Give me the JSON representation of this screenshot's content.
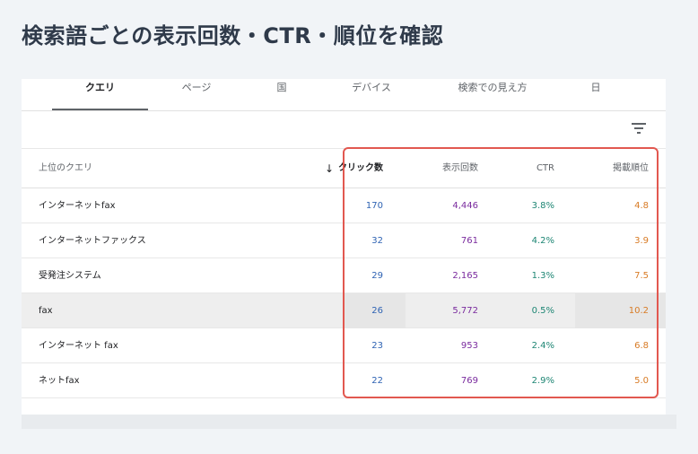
{
  "page": {
    "title": "検索語ごとの表示回数・CTR・順位を確認"
  },
  "tabs": [
    {
      "label": "クエリ",
      "active": true
    },
    {
      "label": "ページ",
      "active": false
    },
    {
      "label": "国",
      "active": false
    },
    {
      "label": "デバイス",
      "active": false
    },
    {
      "label": "検索での見え方",
      "active": false
    },
    {
      "label": "日",
      "active": false
    }
  ],
  "filter": {
    "icon": "filter-list-icon"
  },
  "table": {
    "headers": {
      "query": "上位のクエリ",
      "clicks": "クリック数",
      "impressions": "表示回数",
      "ctr": "CTR",
      "position": "掲載順位"
    },
    "sort_icon": "arrow-down-icon",
    "rows": [
      {
        "query": "インターネットfax",
        "clicks": "170",
        "impressions": "4,446",
        "ctr": "3.8%",
        "position": "4.8"
      },
      {
        "query": "インターネットファックス",
        "clicks": "32",
        "impressions": "761",
        "ctr": "4.2%",
        "position": "3.9"
      },
      {
        "query": "受発注システム",
        "clicks": "29",
        "impressions": "2,165",
        "ctr": "1.3%",
        "position": "7.5"
      },
      {
        "query": "fax",
        "clicks": "26",
        "impressions": "5,772",
        "ctr": "0.5%",
        "position": "10.2"
      },
      {
        "query": "インターネット fax",
        "clicks": "23",
        "impressions": "953",
        "ctr": "2.4%",
        "position": "6.8"
      },
      {
        "query": "ネットfax",
        "clicks": "22",
        "impressions": "769",
        "ctr": "2.9%",
        "position": "5.0"
      }
    ],
    "highlighted_row": 3
  },
  "colors": {
    "clicks": "#2f63b3",
    "impressions": "#7a2b9e",
    "ctr": "#1e8674",
    "position": "#d87b25",
    "highlight_box": "#e25850"
  }
}
